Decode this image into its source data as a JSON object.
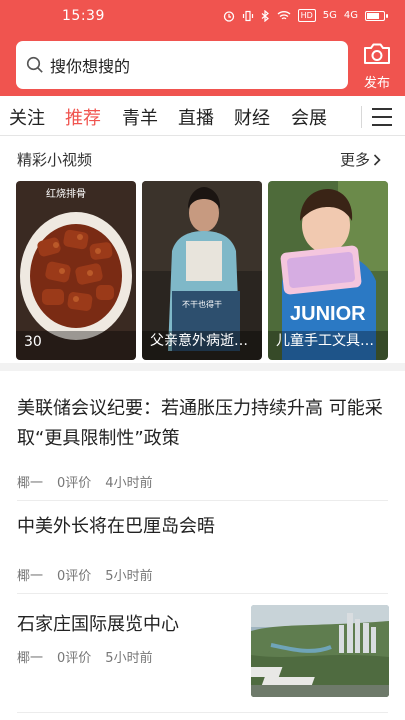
{
  "status_bar": {
    "time": "15:39",
    "hd_tag": "HD",
    "net1": "5G",
    "net2": "4G"
  },
  "search": {
    "placeholder": "搜你想搜的"
  },
  "publish": {
    "label": "发布"
  },
  "tabs": [
    {
      "label": "关注",
      "active": false
    },
    {
      "label": "推荐",
      "active": true
    },
    {
      "label": "青羊",
      "active": false
    },
    {
      "label": "直播",
      "active": false
    },
    {
      "label": "财经",
      "active": false
    },
    {
      "label": "会展",
      "active": false
    }
  ],
  "videos": {
    "title": "精彩小视频",
    "more": "更多",
    "items": [
      {
        "caption": "30",
        "overlay_text": "红烧排骨"
      },
      {
        "caption": "父亲意外病逝…",
        "overlay_text": "不干也得干"
      },
      {
        "caption": "儿童手工文具…",
        "overlay_text": "JUNIOR"
      }
    ]
  },
  "articles": [
    {
      "title": "美联储会议纪要：若通胀压力持续升高 可能采取“更具限制性”政策",
      "source": "椰一",
      "comments": "0评价",
      "time": "4小时前"
    },
    {
      "title": "中美外长将在巴厘岛会晤",
      "source": "椰一",
      "comments": "0评价",
      "time": "5小时前"
    },
    {
      "title": "石家庄国际展览中心",
      "source": "椰一",
      "comments": "0评价",
      "time": "5小时前"
    }
  ],
  "colors": {
    "brand": "#f0544f"
  }
}
